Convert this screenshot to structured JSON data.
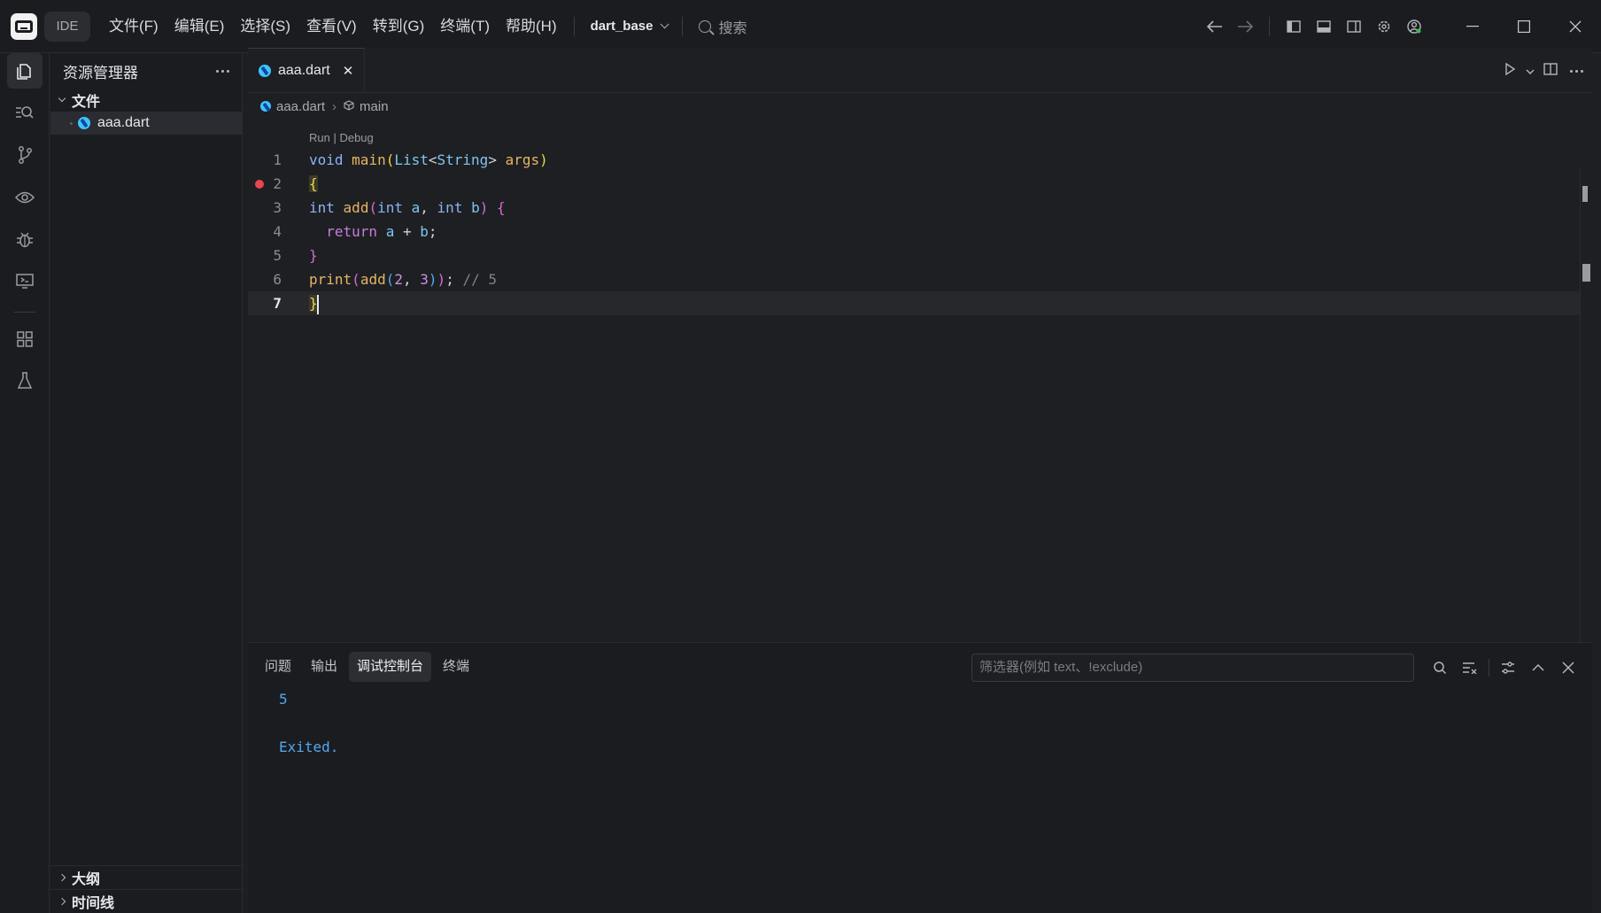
{
  "titlebar": {
    "ide_label": "IDE",
    "menus": [
      "文件(F)",
      "编辑(E)",
      "选择(S)",
      "查看(V)",
      "转到(G)",
      "终端(T)",
      "帮助(H)"
    ],
    "project": "dart_base",
    "search_label": "搜索"
  },
  "sidebar": {
    "title": "资源管理器",
    "folder": "文件",
    "files": [
      "aaa.dart"
    ],
    "outline": "大纲",
    "timeline": "时间线"
  },
  "editor": {
    "tab_label": "aaa.dart",
    "breadcrumb_file": "aaa.dart",
    "breadcrumb_symbol": "main",
    "codelens": "Run | Debug",
    "line_numbers": [
      "1",
      "2",
      "3",
      "4",
      "5",
      "6",
      "7"
    ],
    "current_line": 7,
    "breakpoint_line": 2
  },
  "panel": {
    "tabs": [
      "问题",
      "输出",
      "调试控制台",
      "终端"
    ],
    "active_tab": "调试控制台",
    "filter_placeholder": "筛选器(例如 text、!exclude)",
    "console_lines": [
      "5",
      "",
      "Exited."
    ]
  }
}
